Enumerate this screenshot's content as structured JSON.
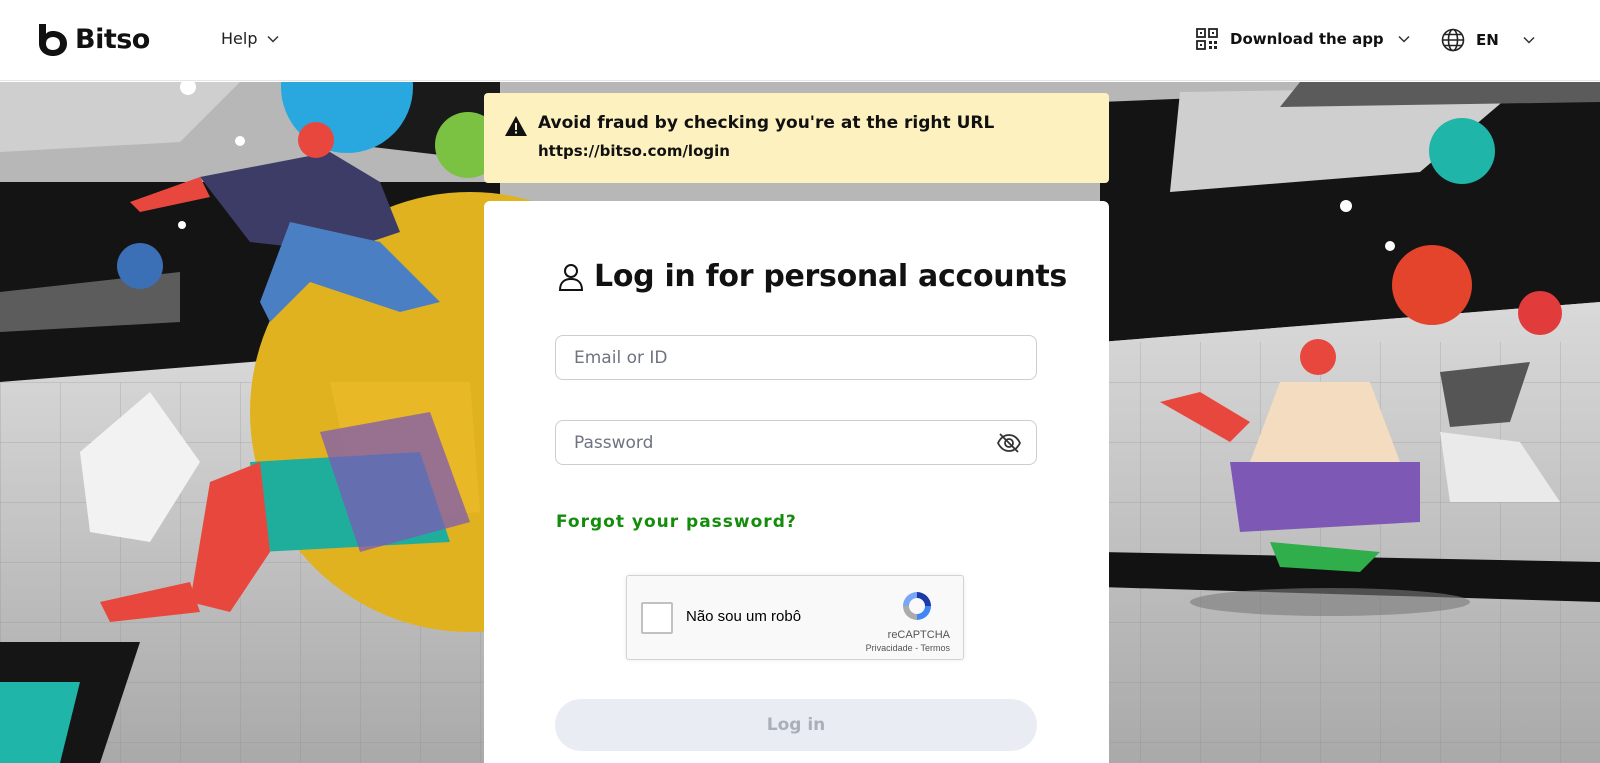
{
  "header": {
    "brand": "Bitso",
    "help_label": "Help",
    "download_label": "Download the app",
    "language_label": "EN"
  },
  "notice": {
    "title": "Avoid fraud by checking you're at the right URL",
    "url": "https://bitso.com/login"
  },
  "login": {
    "title": "Log in for personal accounts",
    "email_placeholder": "Email or ID",
    "password_placeholder": "Password",
    "forgot_label": "Forgot your password?",
    "submit_label": "Log in"
  },
  "captcha": {
    "label": "Não sou um robô",
    "brand": "reCAPTCHA",
    "links": "Privacidade - Termos"
  },
  "colors": {
    "accent_green": "#148c0c",
    "notice_bg": "#fdf1c0",
    "button_disabled_bg": "#e9edf3"
  }
}
